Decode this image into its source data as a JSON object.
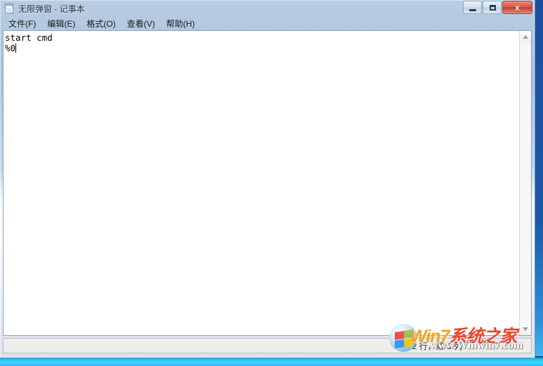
{
  "window": {
    "title": "无限弹窗 - 记事本",
    "app_icon": "notepad-icon",
    "controls": {
      "minimize": "−",
      "maximize": "□",
      "close": "x"
    }
  },
  "menubar": {
    "items": [
      {
        "label": "文件(F)"
      },
      {
        "label": "编辑(E)"
      },
      {
        "label": "格式(O)"
      },
      {
        "label": "查看(V)"
      },
      {
        "label": "帮助(H)"
      }
    ]
  },
  "editor": {
    "line1": "start cmd",
    "line2": "%0"
  },
  "scrollbar": {
    "up_arrow": "▲",
    "down_arrow": "▼"
  },
  "statusbar": {
    "position": "第 2 行，第 3 列"
  },
  "watermark": {
    "brand_win": "Win",
    "brand_seven": "7",
    "brand_cn": "系统之家",
    "url": "www.Winwin7.com"
  },
  "colors": {
    "close_button": "#bf3e30",
    "title_gradient_top": "#b9cde2",
    "watermark_orange": "#f07d18",
    "watermark_red": "#e8452f",
    "desktop_blue": "#1b4f9c"
  }
}
